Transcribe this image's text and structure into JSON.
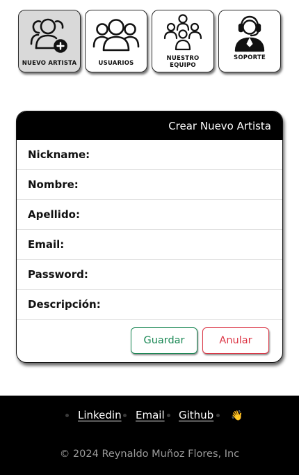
{
  "nav": {
    "tiles": [
      {
        "label": "NUEVO ARTISTA",
        "icon": "add-user-icon"
      },
      {
        "label": "USUARIOS",
        "icon": "users-icon"
      },
      {
        "label": "NUESTRO EQUIPO",
        "icon": "team-icon"
      },
      {
        "label": "SOPORTE",
        "icon": "support-agent-icon"
      }
    ]
  },
  "form": {
    "title": "Crear Nuevo Artista",
    "fields": [
      {
        "label": "Nickname:"
      },
      {
        "label": "Nombre:"
      },
      {
        "label": "Apellido:"
      },
      {
        "label": "Email:"
      },
      {
        "label": "Password:"
      },
      {
        "label": "Descripción:"
      }
    ],
    "save_label": "Guardar",
    "cancel_label": "Anular"
  },
  "footer": {
    "links": [
      "Linkedin",
      "Email",
      "Github"
    ],
    "emoji": "👋",
    "copyright": "© 2024 Reynaldo Muñoz Flores, Inc"
  },
  "colors": {
    "save": "#198754",
    "cancel": "#dc3545",
    "header_bg": "#000000",
    "footer_bg": "#000000",
    "active_tile": "#d9d9d9"
  }
}
